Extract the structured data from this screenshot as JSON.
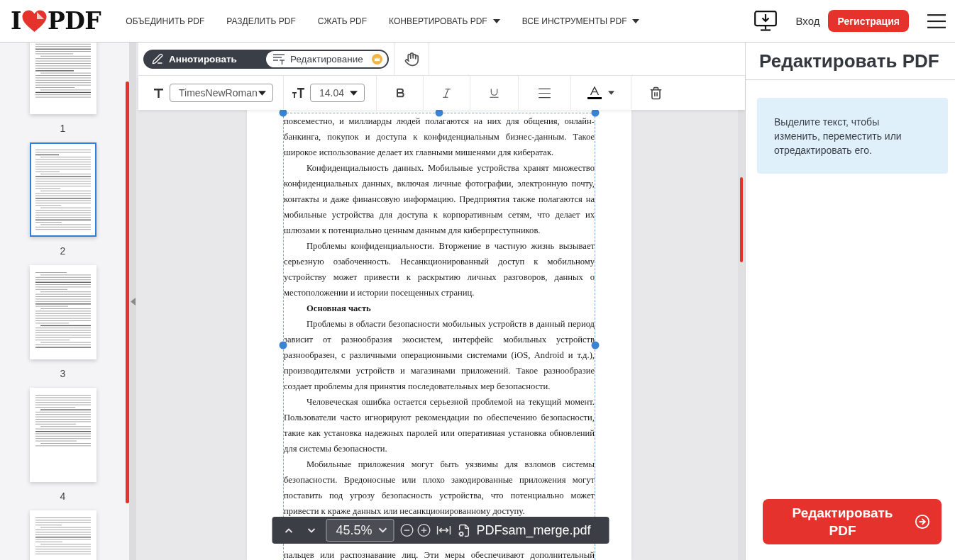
{
  "header": {
    "logo": {
      "left": "I",
      "right": "PDF"
    },
    "nav": [
      {
        "label": "ОБЪЕДИНИТЬ PDF",
        "dropdown": false
      },
      {
        "label": "РАЗДЕЛИТЬ PDF",
        "dropdown": false
      },
      {
        "label": "СЖАТЬ PDF",
        "dropdown": false
      },
      {
        "label": "КОНВЕРТИРОВАТЬ PDF",
        "dropdown": true
      },
      {
        "label": "ВСЕ ИНСТРУМЕНТЫ PDF",
        "dropdown": true
      }
    ],
    "login": "Вход",
    "signup": "Регистрация"
  },
  "thumbnails": [
    {
      "label": "1",
      "selected": false
    },
    {
      "label": "2",
      "selected": true
    },
    {
      "label": "3",
      "selected": false
    },
    {
      "label": "4",
      "selected": false
    },
    {
      "selected": false
    }
  ],
  "modes": [
    {
      "kind": "annotate",
      "label": "Аннотировать",
      "selected": false,
      "premium": false
    },
    {
      "kind": "edit",
      "label": "Редактирование",
      "selected": true,
      "premium": true
    }
  ],
  "text_toolbar": {
    "font": "TimesNewRoman",
    "size": "14.04",
    "tools": [
      {
        "kind": "bold"
      },
      {
        "kind": "italic"
      },
      {
        "kind": "underline"
      },
      {
        "kind": "align"
      },
      {
        "kind": "color",
        "color": "#000000"
      },
      {
        "kind": "delete"
      }
    ]
  },
  "document": {
    "blocks": [
      {
        "kind": "continuation",
        "text": "повсеместно, и миллиарды людей полагаются на них для общения, онлайн-банкинга, покупок и доступа к конфиденциальным бизнес-данным. Такое широкое использование делает их главными мишенями для кибератак."
      },
      {
        "kind": "paragraph",
        "text": "Конфиденциальность данных. Мобильные устройства хранят множество конфиденциальных данных, включая личные фотографии, электронную почту, контакты и даже финансовую информацию. Предприятия также полагаются на мобильные устройства для доступа к корпоративным сетям, что делает их шлюзами к потенциально ценным данным для киберпреступников."
      },
      {
        "kind": "paragraph",
        "text": "Проблемы конфиденциальности. Вторжение в частную жизнь вызывает серьезную озабоченность. Несанкционированный доступ к мобильному устройству может привести к раскрытию личных разговоров, данных о местоположении и истории посещенных страниц."
      },
      {
        "kind": "heading",
        "text": "Основная часть"
      },
      {
        "kind": "paragraph",
        "text": "Проблемы в области безопасности мобильных устройств в данный период зависит от разнообразия экосистем, интерфейс мобильных устройств разнообразен, с различными операционными системами (iOS, Android и т.д.), производителями устройств и магазинами приложений. Такое разнообразие создает проблемы для принятия последовательных мер безопасности."
      },
      {
        "kind": "paragraph",
        "text": "Человеческая ошибка остается серьезной проблемой на текущий момент. Пользователи часто игнорируют рекомендации по обеспечению безопасности, такие как установка надежных паролей или оперативная установка обновлений для системы безопасности."
      },
      {
        "kind": "paragraph",
        "text": "Мобильные приложения могут быть уязвимы для взломов системы безопасности. Вредоносные или плохо закодированные приложения могут поставить под угрозу безопасность устройства, что потенциально может привести к краже данных или несанкционированному доступу."
      },
      {
        "kind": "fragment",
        "text": "пальцев или распознавание лиц. Эти меры обеспечивают дополнительный"
      }
    ]
  },
  "viewer_bar": {
    "zoom": "45.5%",
    "file_name": "PDFsam_merge.pdf"
  },
  "side_panel": {
    "title": "Редактировать PDF",
    "hint": "Выделите текст, чтобы изменить, переместить или отредактировать его.",
    "action": "Редактировать PDF"
  }
}
